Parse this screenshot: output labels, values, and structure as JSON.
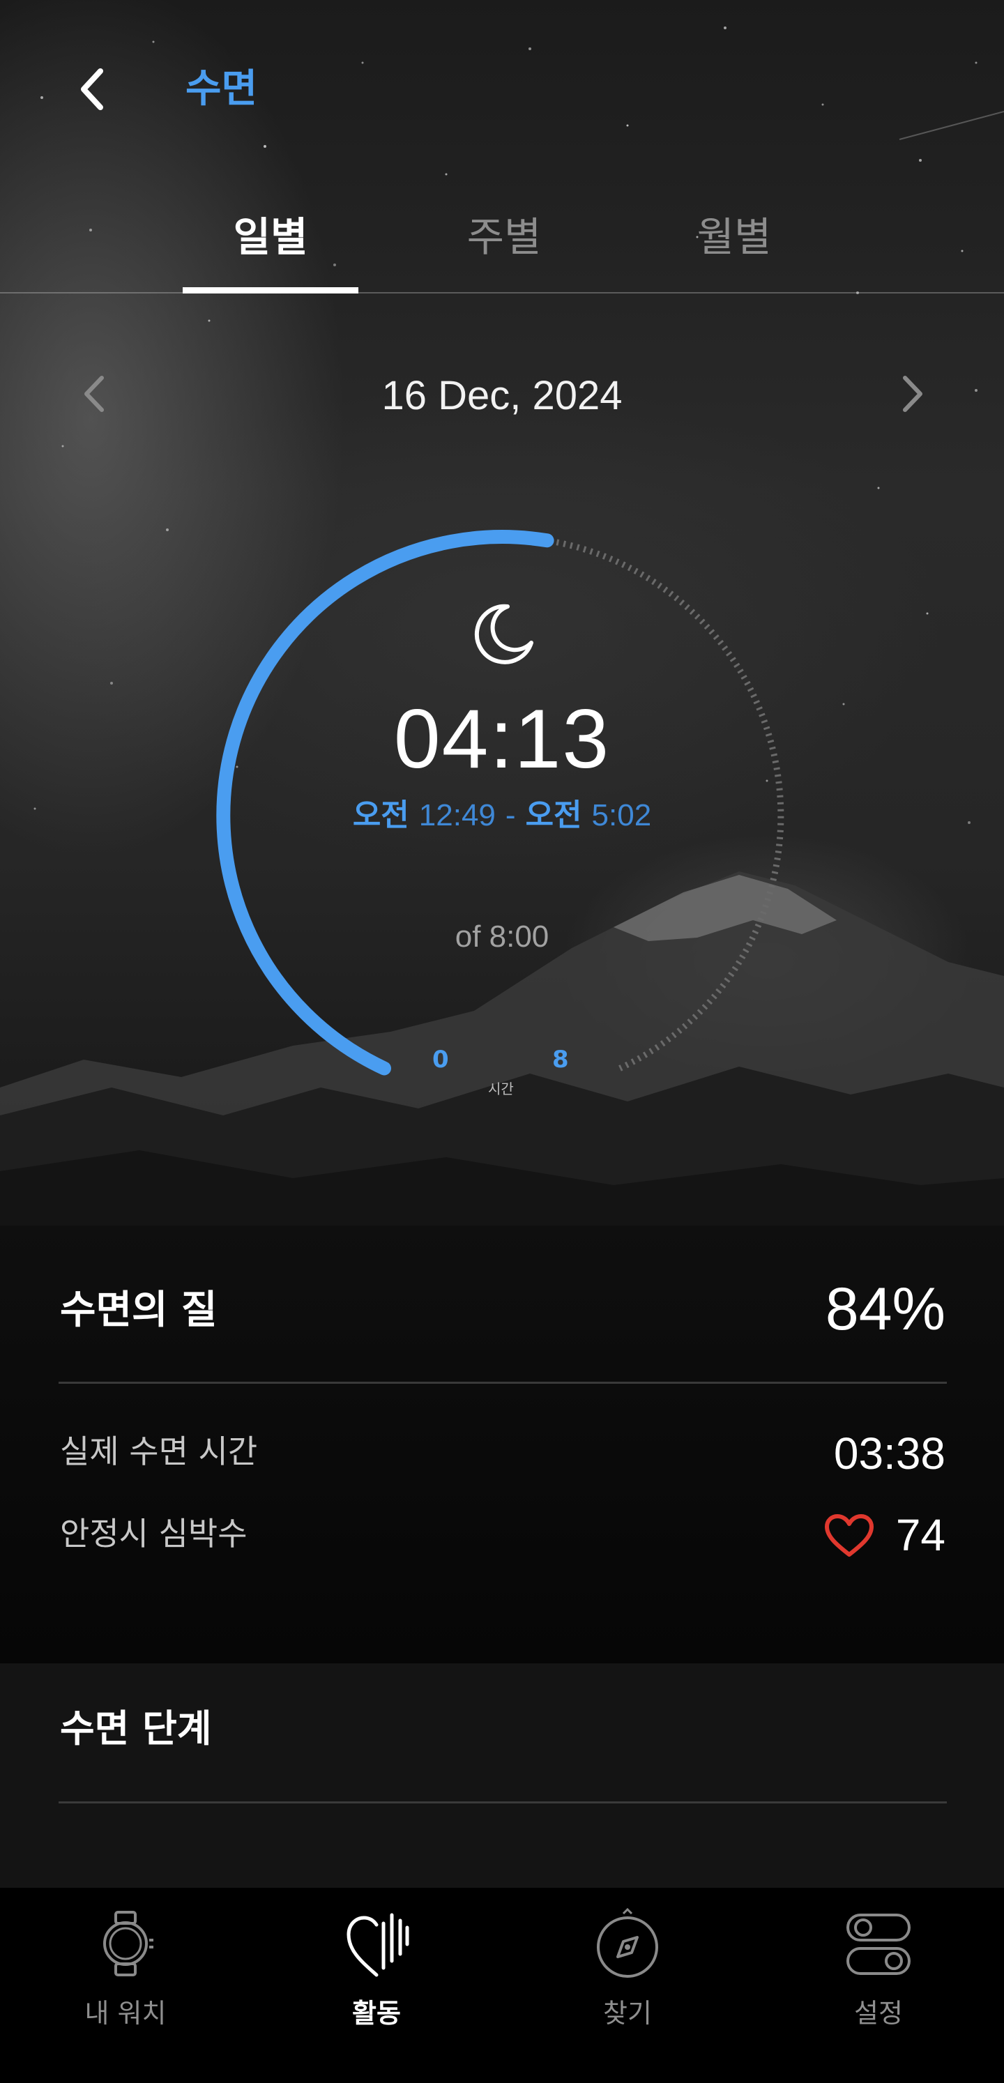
{
  "header": {
    "title": "수면"
  },
  "tabs": [
    {
      "label": "일별",
      "active": true
    },
    {
      "label": "주별",
      "active": false
    },
    {
      "label": "월별",
      "active": false
    }
  ],
  "date": {
    "label": "16 Dec, 2024"
  },
  "summary": {
    "duration": "04:13",
    "start_ampm": "오전",
    "start_time": "12:49",
    "separator": "-",
    "end_ampm": "오전",
    "end_time": "5:02",
    "goal": "of 8:00",
    "progress_fraction": 0.53,
    "scale_start": "0",
    "scale_end": "8",
    "scale_unit": "시간"
  },
  "quality": {
    "title": "수면의 질",
    "value": "84%",
    "rows": [
      {
        "label": "실제 수면 시간",
        "value": "03:38"
      },
      {
        "label": "안정시 심박수",
        "value": "74",
        "icon": "heart-icon"
      }
    ]
  },
  "stages": {
    "title": "수면 단계"
  },
  "nav": [
    {
      "label": "내 워치",
      "icon": "watch-icon",
      "active": false
    },
    {
      "label": "활동",
      "icon": "activity-icon",
      "active": true
    },
    {
      "label": "찾기",
      "icon": "compass-icon",
      "active": false
    },
    {
      "label": "설정",
      "icon": "settings-toggle-icon",
      "active": false
    }
  ],
  "colors": {
    "accent": "#4a9df0",
    "heart": "#e0382e",
    "background": "#000000"
  }
}
